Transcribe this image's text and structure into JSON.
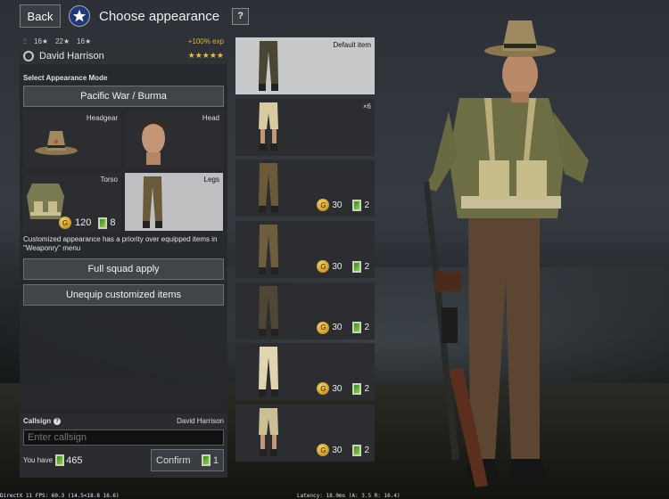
{
  "header": {
    "back_label": "Back",
    "title": "Choose appearance",
    "help_label": "?"
  },
  "soldier": {
    "stats": [
      "16",
      "22",
      "16"
    ],
    "exp_bonus": "+100% exp",
    "name": "David Harrison",
    "stars": "★★★★★"
  },
  "appearance_mode": {
    "label": "Select Appearance Mode",
    "value": "Pacific War / Burma"
  },
  "slots": [
    {
      "label": "Headgear",
      "selected": false
    },
    {
      "label": "Head",
      "selected": false
    },
    {
      "label": "Torso",
      "selected": false,
      "price_gold": "120",
      "price_tickets": "8"
    },
    {
      "label": "Legs",
      "selected": true
    }
  ],
  "note": "Customized appearance has a priority over equipped items in \"Weaponry\" menu",
  "buttons": {
    "full_squad": "Full squad apply",
    "unequip": "Unequip customized items"
  },
  "callsign": {
    "label": "Callsign",
    "current_name": "David Harrison",
    "placeholder": "Enter callsign",
    "you_have_label": "You have",
    "you_have_value": "465",
    "confirm_label": "Confirm",
    "confirm_cost": "1"
  },
  "items": [
    {
      "tag": "Default item",
      "selected": true,
      "color": "#4a4534"
    },
    {
      "tag": "×6",
      "selected": false,
      "color": "#d8cba2"
    },
    {
      "tag": "",
      "gold": "30",
      "tickets": "2",
      "color": "#6b5a3a"
    },
    {
      "tag": "",
      "gold": "30",
      "tickets": "2",
      "color": "#6e5e3e"
    },
    {
      "tag": "",
      "gold": "30",
      "tickets": "2",
      "color": "#4f4636"
    },
    {
      "tag": "",
      "gold": "30",
      "tickets": "2",
      "color": "#e0d5b0"
    },
    {
      "tag": "",
      "gold": "30",
      "tickets": "2",
      "color": "#cdbf95"
    }
  ],
  "debug": {
    "fps": "DirectX 11 FPS: 60.3 (14.5<18.8 16.6)",
    "latency": "Latency: 18.0ms (A: 3.5 R: 16.4)"
  },
  "colors": {
    "accent_gold": "#e0b13a",
    "star_badge": "#1e3a78",
    "panel_bg": "#26282c"
  }
}
